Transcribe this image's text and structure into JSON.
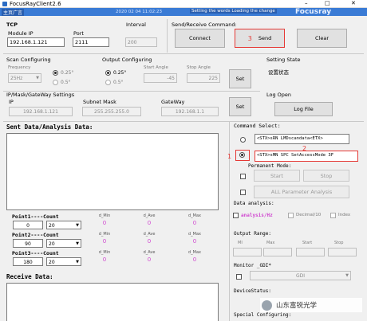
{
  "window": {
    "title": "FocusRayClient2.6"
  },
  "menu_fragment": "主页广言",
  "header_status": {
    "date": "2020 02 04 11:02:23",
    "msg": "Setting the words Loading the change",
    "brand": "Focusray"
  },
  "tcp": {
    "label": "TCP",
    "module_ip_label": "Module IP",
    "module_ip": "192.168.1.121",
    "port_label": "Port",
    "port": "2111"
  },
  "interval": {
    "label": "Interval",
    "value": "200"
  },
  "send_receive": {
    "label": "Send/Receive Command:",
    "connect": "Connect",
    "send": "Send",
    "clear": "Clear",
    "annotation": "3"
  },
  "scan": {
    "label": "Scan Configuring",
    "frequency_label": "Frequency",
    "frequency": "25Hz",
    "opt1": "0.25°",
    "opt2": "0.5°"
  },
  "output": {
    "label": "Output Configuring",
    "opt1": "0.25°",
    "opt2": "0.5°",
    "start_label": "Start Angle",
    "start": "-45",
    "stop_label": "Stop Angle",
    "stop": "225",
    "set": "Set"
  },
  "setting_state": {
    "label": "Setting State",
    "value": "设置状态"
  },
  "ipmask": {
    "label": "IP/Mask/GateWay Settings",
    "ip_label": "IP",
    "ip": "192.168.1.121",
    "mask_label": "Subnet Mask",
    "mask": "255.255.255.0",
    "gw_label": "GateWay",
    "gw": "192.168.1.1",
    "set": "Set"
  },
  "log": {
    "label": "Log Open",
    "button": "Log File"
  },
  "sent": {
    "label": "Sent Data/Analysis Data:"
  },
  "points": [
    {
      "label": "Point1----Count",
      "value": "0",
      "count": "20",
      "min_label": "d_Min",
      "min": "0",
      "ave_label": "d_Ave",
      "ave": "0",
      "max_label": "d_Max",
      "max": "0"
    },
    {
      "label": "Point2----Count",
      "value": "90",
      "count": "20",
      "min_label": "d_Min",
      "min": "0",
      "ave_label": "d_Ave",
      "ave": "0",
      "max_label": "d_Max",
      "max": "0"
    },
    {
      "label": "Point3----Count",
      "value": "180",
      "count": "20",
      "min_label": "d_Min",
      "min": "0",
      "ave_label": "d_Ave",
      "ave": "0",
      "max_label": "d_Max",
      "max": "0"
    }
  ],
  "receive": {
    "label": "Receive Data:"
  },
  "command_select": {
    "label": "Command Select:",
    "cmd1": "<STX>sRN LMDscandata<ETX>",
    "cmd2": "<STX>sMN SPC SetAccessMode 3F",
    "annot1": "1",
    "annot2": "2",
    "permanent_label": "Permanent Mode:",
    "start": "Start",
    "stop": "Stop",
    "all_param": "ALL Parameter Analysis"
  },
  "data_analysis": {
    "label": "Data analysis:",
    "analysis": "analysis/Hz",
    "decimal": "Decimal/10",
    "index": "Index"
  },
  "output_range": {
    "label": "Output Range:",
    "m1": "MI",
    "max": "Max",
    "start": "Start",
    "stop": "Stop"
  },
  "monitor": {
    "label": "Monitor _GDI*",
    "value": "GDI"
  },
  "device_status": {
    "label": "DeviceStatus:"
  },
  "special": {
    "label": "Special Configuring:"
  },
  "watermark": {
    "text": "山东富锐光学"
  },
  "colors": {
    "annotation": "#e53935",
    "value": "#d046d0"
  }
}
